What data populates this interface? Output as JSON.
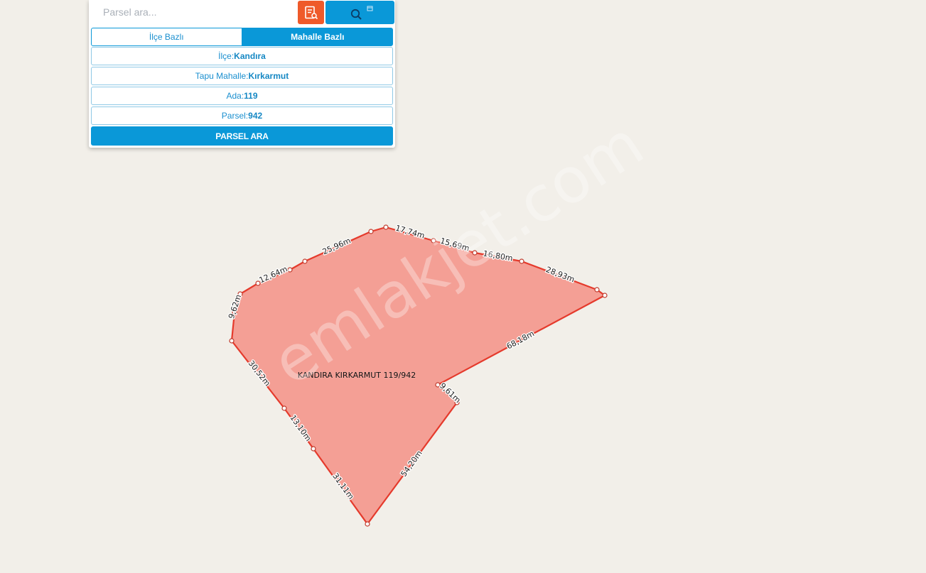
{
  "search": {
    "placeholder": "Parsel ara..."
  },
  "buttons": {
    "report_icon": "report-search-icon",
    "search_icon": "search-icon",
    "parsel_ara": "PARSEL ARA"
  },
  "tabs": [
    {
      "label": "İlçe Bazlı",
      "active": false
    },
    {
      "label": "Mahalle Bazlı",
      "active": true
    }
  ],
  "fields": {
    "ilce": {
      "label": "İlçe:",
      "value": "Kandıra"
    },
    "mahalle": {
      "label": "Tapu Mahalle:",
      "value": "Kırkarmut"
    },
    "ada": {
      "label": "Ada:",
      "value": "119"
    },
    "parsel": {
      "label": "Parsel:",
      "value": "942"
    }
  },
  "map": {
    "parcel_label": "KANDIRA KIRKARMUT 119/942",
    "watermark": "emlakjet.com",
    "segment_labels": [
      "17,74m",
      "15,69m",
      "16,80m",
      "28,93m",
      "68,18m",
      "9,61m",
      "54,20m",
      "31,11m",
      "13,10m",
      "30,52m",
      "9,62m",
      "12,64m",
      "25,96m"
    ],
    "colors": {
      "fill": "#f4988d",
      "stroke": "#e53a2c",
      "background": "#f2efe9",
      "accent": "#0a98d8",
      "report_button": "#ef5a2a"
    }
  }
}
